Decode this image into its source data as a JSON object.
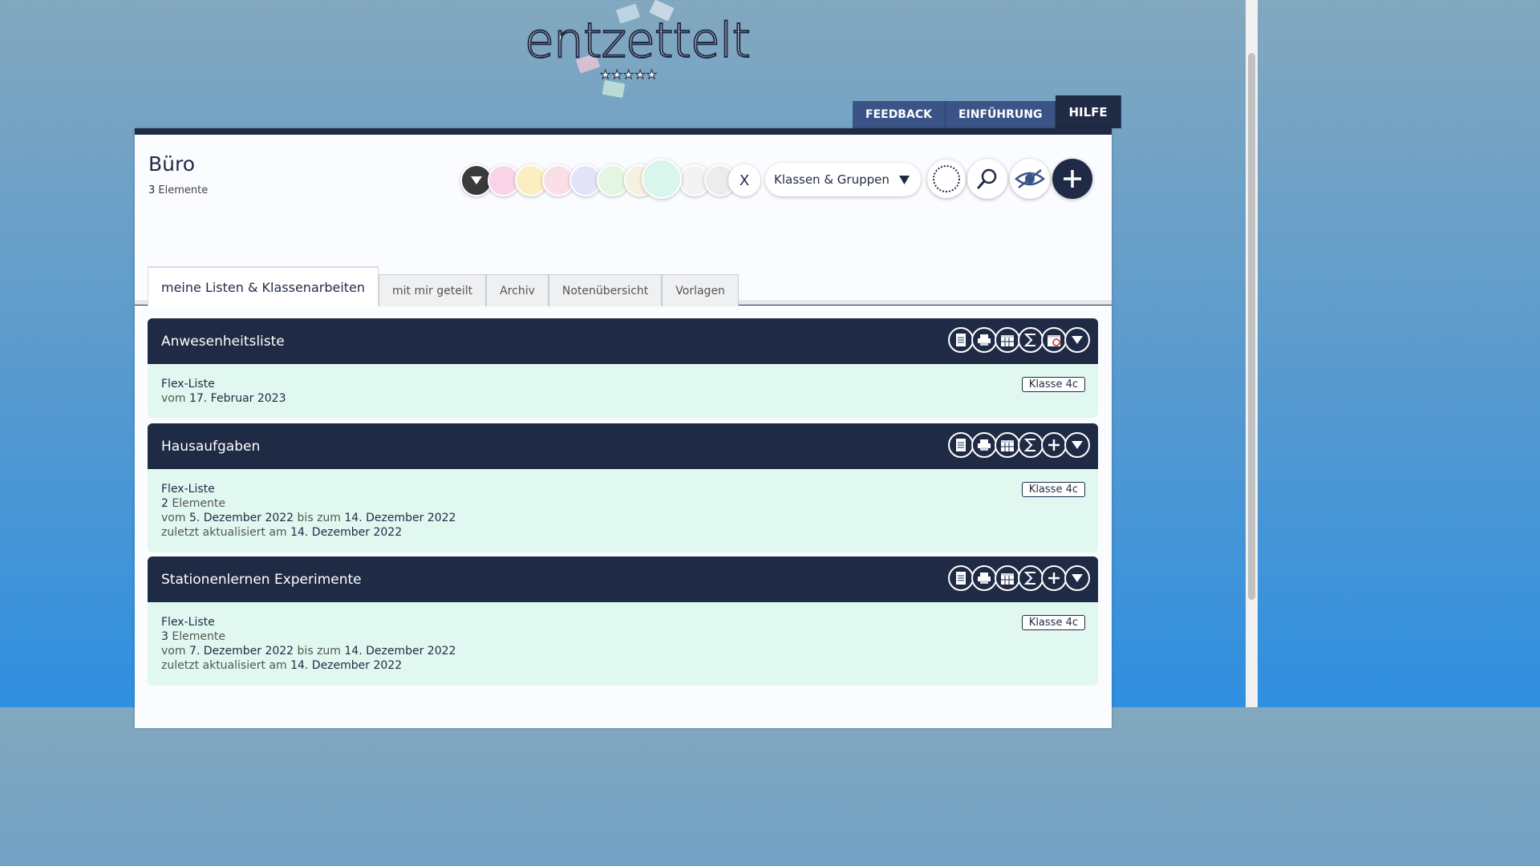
{
  "logo": {
    "text": "entzettelt",
    "stars": "★★★★★"
  },
  "topnav": {
    "items": [
      "FEEDBACK",
      "EINFÜHRUNG",
      "HILFE"
    ]
  },
  "panel": {
    "title": "Büro",
    "count_number": "3",
    "count_label": "Elemente",
    "color_filter": {
      "colors": [
        "#f9d3e6",
        "#fbeec0",
        "#fadfe6",
        "#e3e3f9",
        "#e2f6e2",
        "#f5f1de",
        "#d8f6ec",
        "#f3f3f3",
        "#ececec"
      ],
      "clear_label": "X"
    },
    "select": {
      "value": "Klassen & Gruppen"
    }
  },
  "tabs": [
    "meine Listen & Klassenarbeiten",
    "mit mir geteilt",
    "Archiv",
    "Notenübersicht",
    "Vorlagen"
  ],
  "cards": [
    {
      "title": "Anwesenheitsliste",
      "type": "Flex-Liste",
      "badge": "Klasse 4c",
      "line1_pre": "vom",
      "line1_val": "17. Februar 2023"
    },
    {
      "title": "Hausaufgaben",
      "type": "Flex-Liste",
      "badge": "Klasse 4c",
      "count_number": "2",
      "count_label": "Elemente",
      "from_pre": "vom",
      "from_val": "5. Dezember 2022",
      "to_pre": "bis zum",
      "to_val": "14. Dezember 2022",
      "upd_pre": "zuletzt aktualisiert am",
      "upd_val": "14. Dezember 2022"
    },
    {
      "title": "Stationenlernen Experimente",
      "type": "Flex-Liste",
      "badge": "Klasse 4c",
      "count_number": "3",
      "count_label": "Elemente",
      "from_pre": "vom",
      "from_val": "7. Dezember 2022",
      "to_pre": "bis zum",
      "to_val": "14. Dezember 2022",
      "upd_pre": "zuletzt aktualisiert am",
      "upd_val": "14. Dezember 2022"
    }
  ]
}
